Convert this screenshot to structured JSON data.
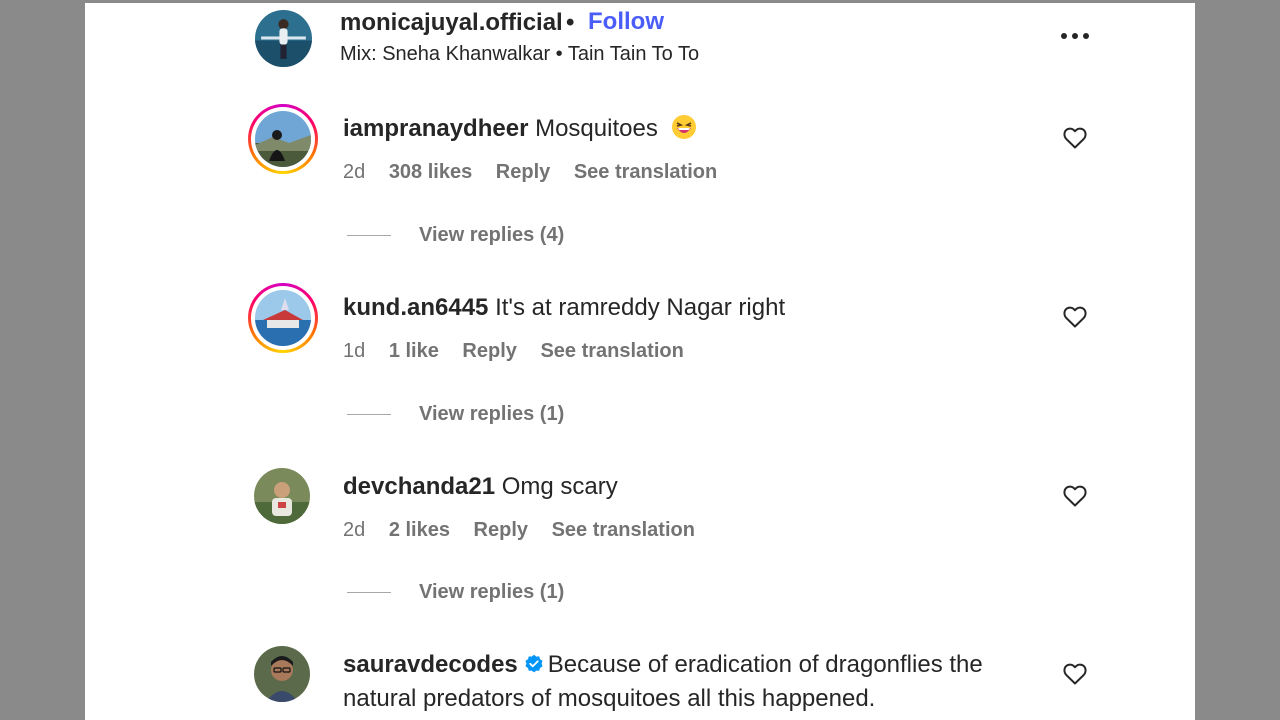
{
  "header": {
    "username": "monicajuyal.official",
    "separator": "•",
    "follow_label": "Follow",
    "audio": "Mix: Sneha Khanwalkar • Tain Tain To To",
    "more_icon": "more-horizontal-icon"
  },
  "comments": [
    {
      "username": "iampranaydheer",
      "text": "Mosquitoes",
      "emoji": "grinning-squinting-face-emoji",
      "age": "2d",
      "likes": "308 likes",
      "reply_label": "Reply",
      "translate_label": "See translation",
      "view_replies": "View replies (4)",
      "has_story_ring": true
    },
    {
      "username": "kund.an6445",
      "text": "It's at ramreddy Nagar right",
      "age": "1d",
      "likes": "1 like",
      "reply_label": "Reply",
      "translate_label": "See translation",
      "view_replies": "View replies (1)",
      "has_story_ring": true
    },
    {
      "username": "devchanda21",
      "text": "Omg scary",
      "age": "2d",
      "likes": "2 likes",
      "reply_label": "Reply",
      "translate_label": "See translation",
      "view_replies": "View replies (1)",
      "has_story_ring": false
    },
    {
      "username": "sauravdecodes",
      "verified": true,
      "text_line1": "Because of eradication of dragonflies the",
      "text_line2": "natural predators of mosquitoes all this happened.",
      "has_story_ring": false
    }
  ],
  "colors": {
    "follow": "#4a5df9",
    "meta": "#737373",
    "verified": "#0095f6",
    "text": "#262626"
  }
}
